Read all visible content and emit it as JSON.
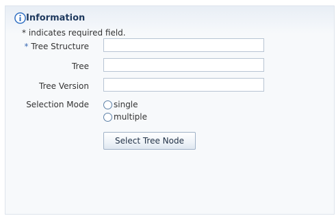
{
  "header": {
    "title": "Information",
    "icon": "info-icon",
    "required_note": "* indicates required field."
  },
  "form": {
    "fields": [
      {
        "required_mark": "*",
        "label": "Tree Structure",
        "value": ""
      },
      {
        "label": "Tree",
        "value": ""
      },
      {
        "label": "Tree Version",
        "value": ""
      }
    ],
    "selection_mode": {
      "label": "Selection Mode",
      "options": [
        "single",
        "multiple"
      ],
      "selected": null
    },
    "select_button_label": "Select Tree Node"
  },
  "colors": {
    "title": "#1f3a5f",
    "required_star": "#3a6ab3",
    "field_border": "#b7c4d3",
    "panel_bg": "#f7f9fb"
  }
}
